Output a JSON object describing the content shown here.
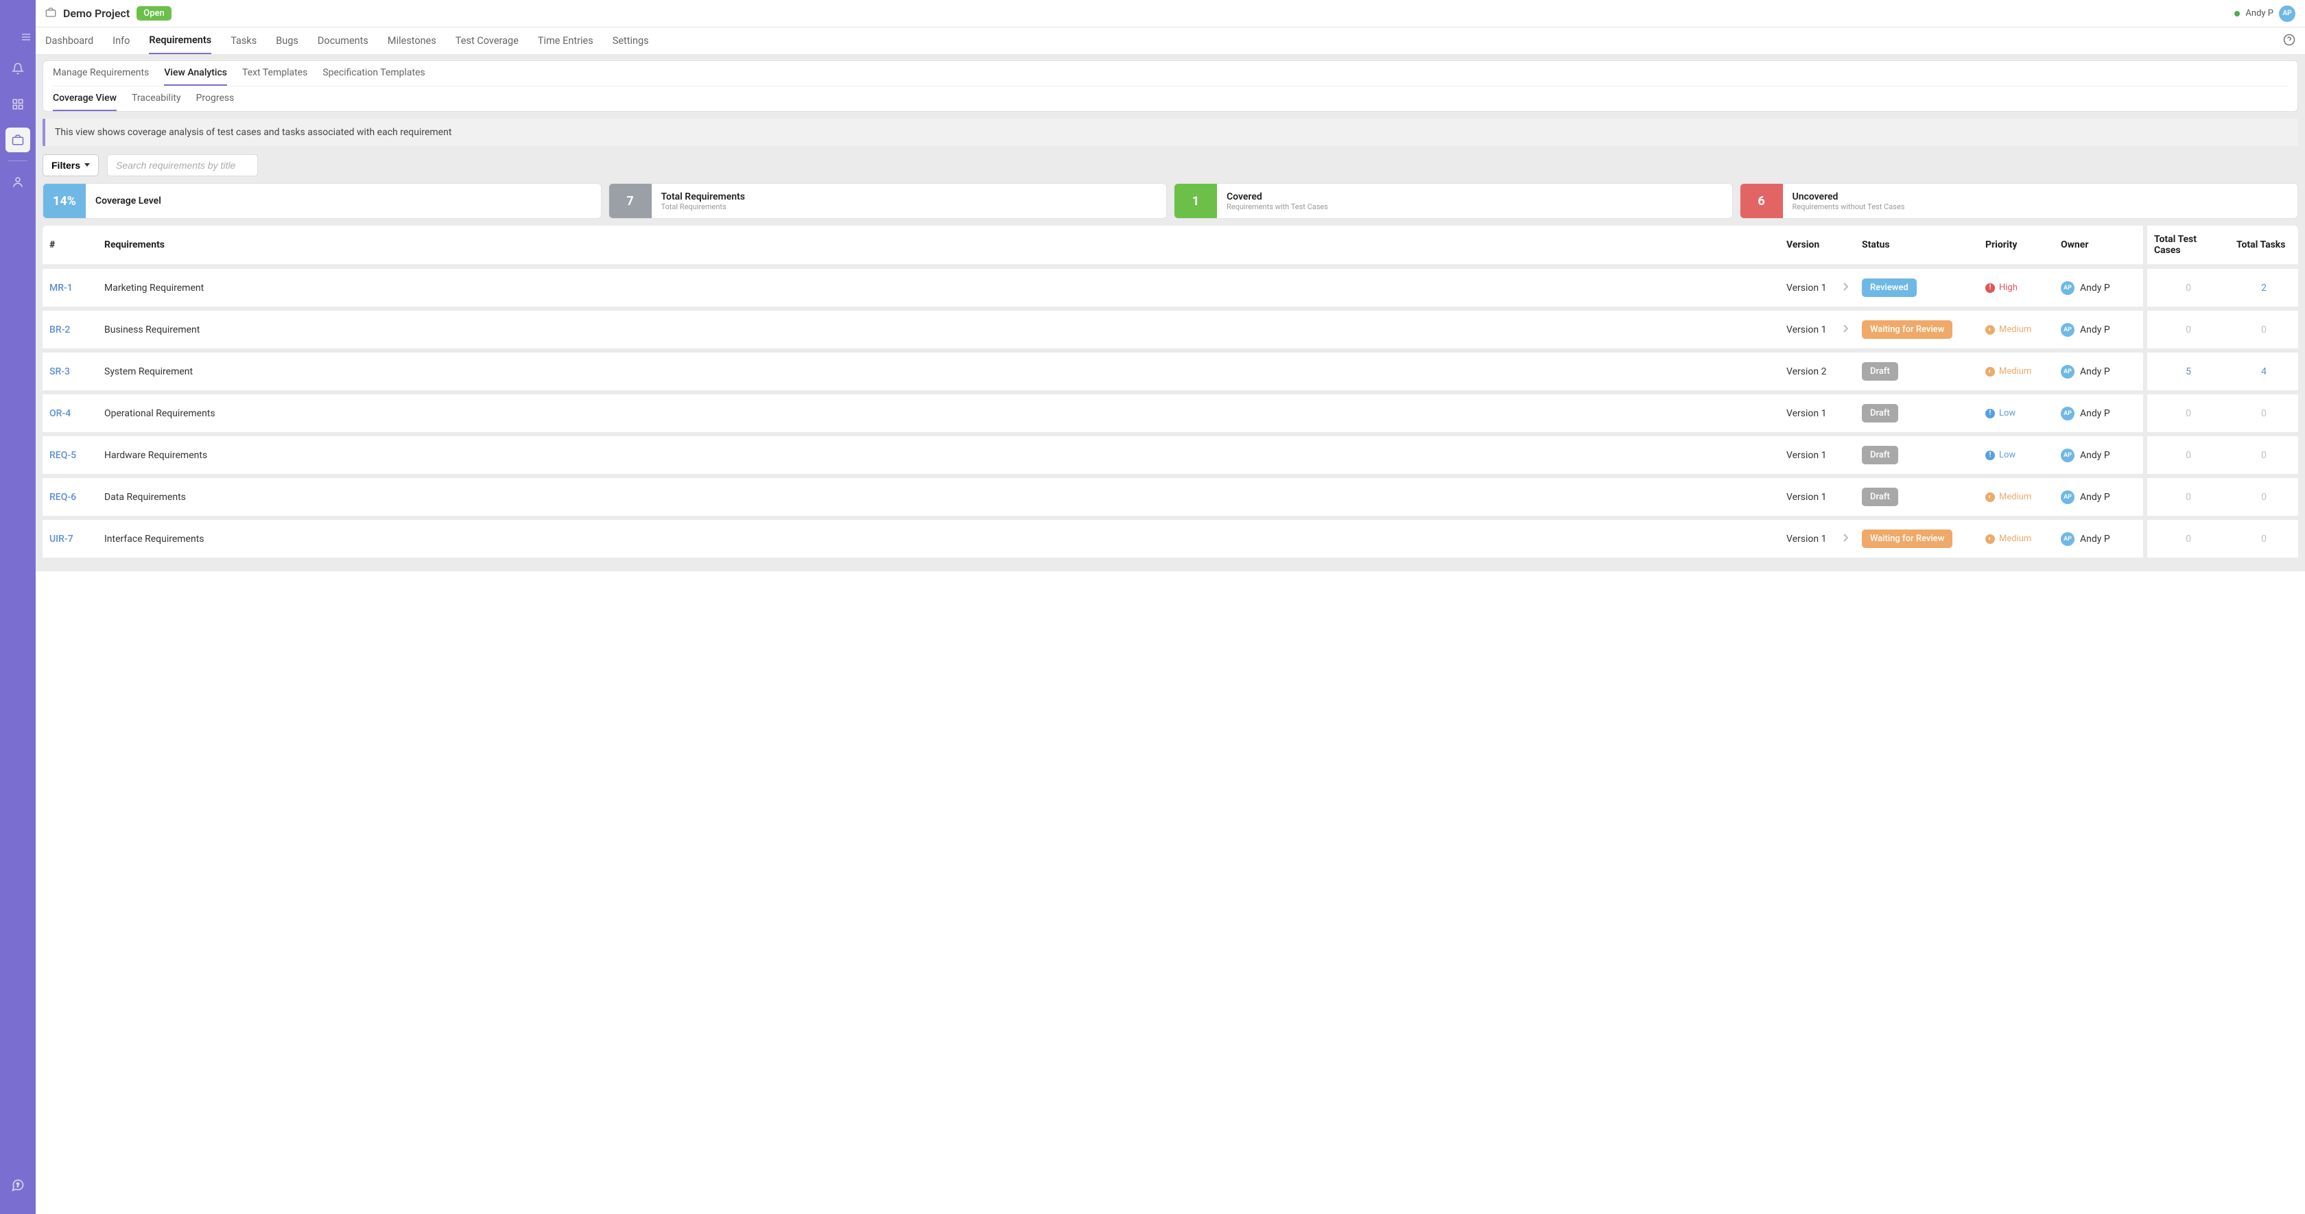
{
  "project": {
    "title": "Demo Project",
    "status": "Open"
  },
  "user": {
    "name": "Andy P",
    "initials": "AP"
  },
  "nav": {
    "tabs": [
      {
        "label": "Dashboard"
      },
      {
        "label": "Info"
      },
      {
        "label": "Requirements",
        "active": true
      },
      {
        "label": "Tasks"
      },
      {
        "label": "Bugs"
      },
      {
        "label": "Documents"
      },
      {
        "label": "Milestones"
      },
      {
        "label": "Test Coverage"
      },
      {
        "label": "Time Entries"
      },
      {
        "label": "Settings"
      }
    ]
  },
  "subnav": {
    "top": [
      {
        "label": "Manage Requirements"
      },
      {
        "label": "View Analytics",
        "active": true
      },
      {
        "label": "Text Templates"
      },
      {
        "label": "Specification Templates"
      }
    ],
    "bottom": [
      {
        "label": "Coverage View",
        "active": true
      },
      {
        "label": "Traceability"
      },
      {
        "label": "Progress"
      }
    ]
  },
  "banner": "This view shows coverage analysis of test cases and tasks associated with each requirement",
  "filters": {
    "button": "Filters",
    "search_placeholder": "Search requirements by title"
  },
  "stats": {
    "coverage": {
      "value": "14%",
      "title": "Coverage Level"
    },
    "total": {
      "value": "7",
      "title": "Total Requirements",
      "sub": "Total Requirements"
    },
    "covered": {
      "value": "1",
      "title": "Covered",
      "sub": "Requirements with Test Cases"
    },
    "uncovered": {
      "value": "6",
      "title": "Uncovered",
      "sub": "Requirements without Test Cases"
    }
  },
  "table": {
    "headers": {
      "id": "#",
      "req": "Requirements",
      "version": "Version",
      "status": "Status",
      "priority": "Priority",
      "owner": "Owner",
      "tests": "Total Test Cases",
      "tasks": "Total Tasks"
    },
    "rows": [
      {
        "id": "MR-1",
        "title": "Marketing Requirement",
        "version": "Version 1",
        "expandable": true,
        "status": "Reviewed",
        "status_class": "badge-reviewed",
        "priority": "High",
        "prio_class": "prio-high",
        "owner": "Andy P",
        "initials": "AP",
        "tests": "0",
        "tests_link": false,
        "tasks": "2",
        "tasks_link": true
      },
      {
        "id": "BR-2",
        "title": "Business Requirement",
        "version": "Version 1",
        "expandable": true,
        "status": "Waiting for Review",
        "status_class": "badge-waiting",
        "priority": "Medium",
        "prio_class": "prio-medium",
        "owner": "Andy P",
        "initials": "AP",
        "tests": "0",
        "tests_link": false,
        "tasks": "0",
        "tasks_link": false
      },
      {
        "id": "SR-3",
        "title": "System Requirement",
        "version": "Version 2",
        "expandable": false,
        "status": "Draft",
        "status_class": "badge-draft",
        "priority": "Medium",
        "prio_class": "prio-medium",
        "owner": "Andy P",
        "initials": "AP",
        "tests": "5",
        "tests_link": true,
        "tasks": "4",
        "tasks_link": true
      },
      {
        "id": "OR-4",
        "title": "Operational Requirements",
        "version": "Version 1",
        "expandable": false,
        "status": "Draft",
        "status_class": "badge-draft",
        "priority": "Low",
        "prio_class": "prio-low",
        "owner": "Andy P",
        "initials": "AP",
        "tests": "0",
        "tests_link": false,
        "tasks": "0",
        "tasks_link": false
      },
      {
        "id": "REQ-5",
        "title": "Hardware Requirements",
        "version": "Version 1",
        "expandable": false,
        "status": "Draft",
        "status_class": "badge-draft",
        "priority": "Low",
        "prio_class": "prio-low",
        "owner": "Andy P",
        "initials": "AP",
        "tests": "0",
        "tests_link": false,
        "tasks": "0",
        "tasks_link": false
      },
      {
        "id": "REQ-6",
        "title": "Data Requirements",
        "version": "Version 1",
        "expandable": false,
        "status": "Draft",
        "status_class": "badge-draft",
        "priority": "Medium",
        "prio_class": "prio-medium",
        "owner": "Andy P",
        "initials": "AP",
        "tests": "0",
        "tests_link": false,
        "tasks": "0",
        "tasks_link": false
      },
      {
        "id": "UIR-7",
        "title": "Interface Requirements",
        "version": "Version 1",
        "expandable": true,
        "status": "Waiting for Review",
        "status_class": "badge-waiting",
        "priority": "Medium",
        "prio_class": "prio-medium",
        "owner": "Andy P",
        "initials": "AP",
        "tests": "0",
        "tests_link": false,
        "tasks": "0",
        "tasks_link": false
      }
    ]
  }
}
